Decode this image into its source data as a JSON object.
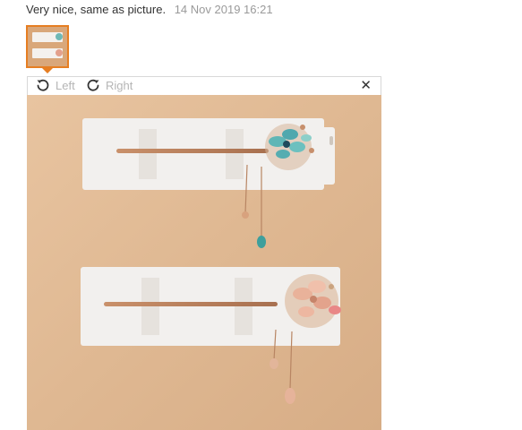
{
  "review": {
    "text": "Very nice, same as picture.",
    "date": "14 Nov 2019 16:21"
  },
  "viewer": {
    "rotate_left_label": "Left",
    "rotate_right_label": "Right",
    "close_symbol": "✕"
  },
  "icons": {
    "rotate_left": "rotate-left-icon",
    "rotate_right": "rotate-right-icon",
    "close": "close-icon"
  },
  "colors": {
    "accent": "#e67e22",
    "muted_text": "#b5b5b5",
    "date_text": "#9a9a9a"
  }
}
